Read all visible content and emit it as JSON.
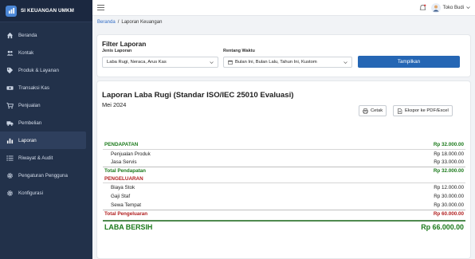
{
  "brand": {
    "title": "SI KEUANGAN UMKM"
  },
  "sidebar": {
    "items": [
      {
        "label": "Beranda",
        "icon": "home-icon"
      },
      {
        "label": "Kontak",
        "icon": "users-icon"
      },
      {
        "label": "Produk & Layanan",
        "icon": "tag-icon"
      },
      {
        "label": "Transaksi Kas",
        "icon": "cash-icon"
      },
      {
        "label": "Penjualan",
        "icon": "cart-icon"
      },
      {
        "label": "Pembelian",
        "icon": "truck-icon"
      },
      {
        "label": "Laporan",
        "icon": "bar-chart-icon",
        "active": true
      },
      {
        "label": "Riwayat & Audit",
        "icon": "list-icon"
      },
      {
        "label": "Pengaturan Pengguna",
        "icon": "gear-icon"
      },
      {
        "label": "Konfigurasi",
        "icon": "gear-icon"
      }
    ]
  },
  "topbar": {
    "user_name": "Toko Budi"
  },
  "breadcrumb": {
    "home": "Beranda",
    "separator": "/",
    "current": "Laporan Keuangan"
  },
  "filter": {
    "title": "Filter Laporan",
    "type_label": "Jenis Laporan",
    "type_value": "Laba Rugi, Neraca, Arus Kas",
    "range_label": "Rentang Waktu",
    "range_value": "Bulan Ini,  Bulan Lalu,  Tahun Ini,  Kustom",
    "submit_label": "Tampilkan"
  },
  "report": {
    "title": "Laporan Laba Rugi (Standar ISO/IEC 25010 Evaluasi)",
    "period": "Mei 2024",
    "print_label": "Cetak",
    "export_label": "Ekspor ke PDF/Excel",
    "rows": [
      {
        "label": "PENDAPATAN",
        "amount": "Rp 32.000.00",
        "kind": "header-green"
      },
      {
        "label": "Penjualan Produk",
        "amount": "Rp 18.000.00",
        "kind": "sub"
      },
      {
        "label": "Jasa Servis",
        "amount": "Rp 33.000.00",
        "kind": "sub"
      },
      {
        "label": "Total Pendapatan",
        "amount": "Rp 32.000.00",
        "kind": "total-green"
      },
      {
        "label": "PENGELUARAN",
        "amount": "",
        "kind": "header-red"
      },
      {
        "label": "Biaya Stok",
        "amount": "Rp 12.000.00",
        "kind": "sub"
      },
      {
        "label": "Gaji Staf",
        "amount": "Rp 30.000.00",
        "kind": "sub"
      },
      {
        "label": "Sewa Tempat",
        "amount": "Rp 30.000.00",
        "kind": "sub"
      },
      {
        "label": "Total Pengeluaran",
        "amount": "Rp 60.000.00",
        "kind": "total-red"
      }
    ],
    "net": {
      "label": "LABA BERSIH",
      "amount": "Rp 66.000.00"
    }
  },
  "colors": {
    "sidebar": "#22314a",
    "primary": "#2566b4",
    "income": "#1b7a1b",
    "expense": "#b01e1e"
  }
}
